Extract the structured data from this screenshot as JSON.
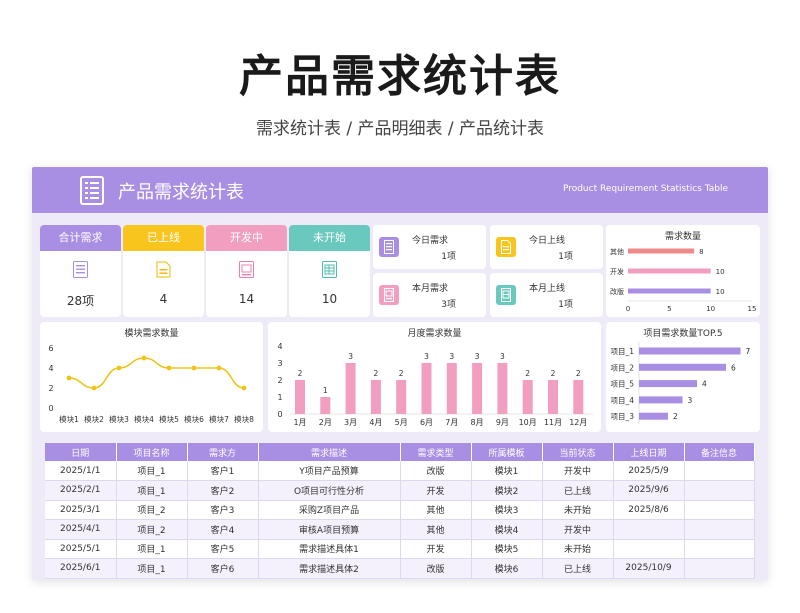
{
  "page": {
    "title": "产品需求统计表",
    "subtitle": "需求统计表 / 产品明细表 / 产品统计表"
  },
  "sheet": {
    "title": "产品需求统计表",
    "title_en": "Product Requirement Statistics Table"
  },
  "status_cards": [
    {
      "label": "合计需求",
      "value": "28项",
      "color": "#a98fe3",
      "icon": "list-doc-icon"
    },
    {
      "label": "已上线",
      "value": "4",
      "color": "#f7c51e",
      "icon": "doc-icon"
    },
    {
      "label": "开发中",
      "value": "14",
      "color": "#f29ec0",
      "icon": "image-doc-icon"
    },
    {
      "label": "未开始",
      "value": "10",
      "color": "#69c9be",
      "icon": "table-doc-icon"
    }
  ],
  "mini_cards": [
    {
      "label": "今日需求",
      "value": "1项",
      "color": "#a98fe3",
      "icon": "list-doc-icon"
    },
    {
      "label": "今日上线",
      "value": "1项",
      "color": "#f7c51e",
      "icon": "doc-icon"
    },
    {
      "label": "本月需求",
      "value": "3项",
      "color": "#f29ec0",
      "icon": "image-doc-icon"
    },
    {
      "label": "本月上线",
      "value": "1项",
      "color": "#69c9be",
      "icon": "table-doc-icon"
    }
  ],
  "chart_data": [
    {
      "type": "bar",
      "orientation": "horizontal",
      "title": "需求数量",
      "categories": [
        "其他",
        "开发",
        "改版"
      ],
      "values": [
        8,
        10,
        10
      ],
      "colors": [
        "#f08a8a",
        "#f29ec0",
        "#a98fe3"
      ],
      "xlim": [
        0,
        15
      ],
      "xticks": [
        "0",
        "5",
        "10",
        "15"
      ]
    },
    {
      "type": "line",
      "title": "模块需求数量",
      "categories": [
        "模块1",
        "模块2",
        "模块3",
        "模块4",
        "模块5",
        "模块6",
        "模块7",
        "模块8"
      ],
      "values": [
        3,
        2,
        4,
        5,
        4,
        4,
        4,
        2
      ],
      "ylim": [
        0,
        6
      ],
      "yticks": [
        "0",
        "2",
        "4",
        "6"
      ],
      "color": "#f0c419"
    },
    {
      "type": "bar",
      "title": "月度需求数量",
      "categories": [
        "1月",
        "2月",
        "3月",
        "4月",
        "5月",
        "6月",
        "7月",
        "8月",
        "9月",
        "10月",
        "11月",
        "12月"
      ],
      "values": [
        2,
        1,
        3,
        2,
        2,
        3,
        3,
        3,
        3,
        2,
        2,
        2
      ],
      "ylim": [
        0,
        4
      ],
      "yticks": [
        "0",
        "1",
        "2",
        "3",
        "4"
      ],
      "color": "#f29ec0"
    },
    {
      "type": "bar",
      "orientation": "horizontal",
      "title": "项目需求数量TOP.5",
      "categories": [
        "项目_1",
        "项目_2",
        "项目_5",
        "项目_4",
        "项目_3"
      ],
      "values": [
        7,
        6,
        4,
        3,
        2
      ],
      "xlim": [
        0,
        8
      ],
      "color": "#a98fe3"
    }
  ],
  "table": {
    "headers": [
      "日期",
      "项目名称",
      "需求方",
      "需求描述",
      "需求类型",
      "所属模板",
      "当前状态",
      "上线日期",
      "备注信息"
    ],
    "rows": [
      [
        "2025/1/1",
        "项目_1",
        "客户1",
        "Y项目产品预算",
        "改版",
        "模块1",
        "开发中",
        "2025/5/9",
        ""
      ],
      [
        "2025/2/1",
        "项目_1",
        "客户2",
        "O项目可行性分析",
        "开发",
        "模块2",
        "已上线",
        "2025/9/6",
        ""
      ],
      [
        "2025/3/1",
        "项目_2",
        "客户3",
        "采购Z项目产品",
        "其他",
        "模块3",
        "未开始",
        "2025/8/6",
        ""
      ],
      [
        "2025/4/1",
        "项目_2",
        "客户4",
        "审核A项目预算",
        "其他",
        "模块4",
        "开发中",
        "",
        ""
      ],
      [
        "2025/5/1",
        "项目_1",
        "客户5",
        "需求描述具体1",
        "开发",
        "模块5",
        "未开始",
        "",
        ""
      ],
      [
        "2025/6/1",
        "项目_1",
        "客户6",
        "需求描述具体2",
        "改版",
        "模块6",
        "已上线",
        "2025/10/9",
        ""
      ]
    ]
  }
}
